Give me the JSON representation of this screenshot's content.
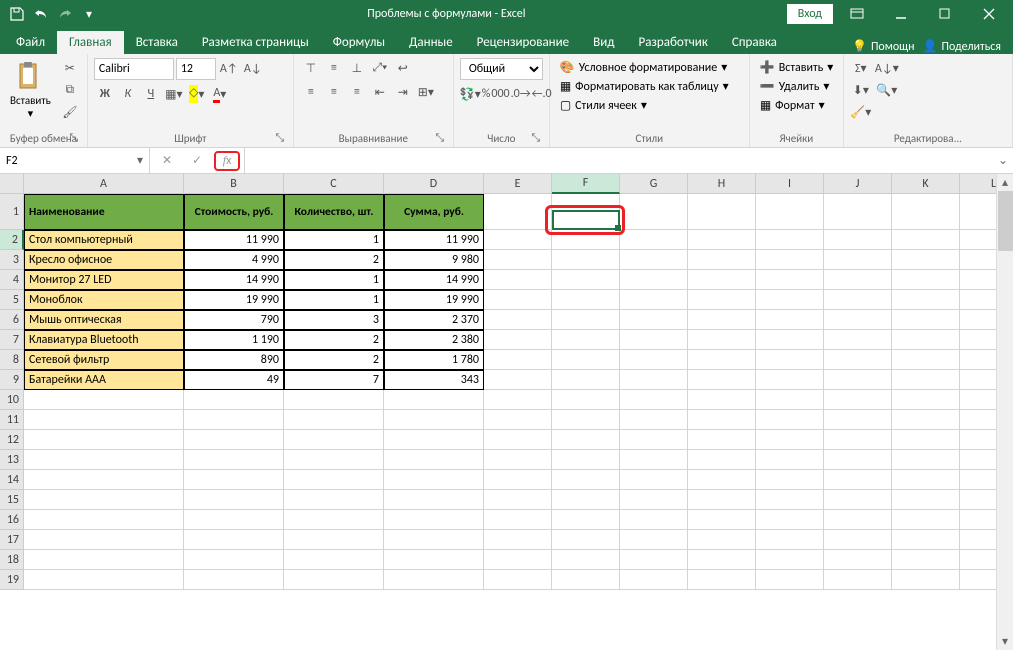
{
  "title": "Проблемы с формулами - Excel",
  "login": "Вход",
  "tabs": [
    "Файл",
    "Главная",
    "Вставка",
    "Разметка страницы",
    "Формулы",
    "Данные",
    "Рецензирование",
    "Вид",
    "Разработчик",
    "Справка"
  ],
  "active_tab": 1,
  "help_hint": "Помощн",
  "share": "Поделиться",
  "ribbon": {
    "clipboard": {
      "paste": "Вставить",
      "label": "Буфер обмена"
    },
    "font": {
      "name": "Calibri",
      "size": "12",
      "label": "Шрифт"
    },
    "alignment": {
      "label": "Выравнивание"
    },
    "number": {
      "format": "Общий",
      "label": "Число"
    },
    "styles": {
      "cond": "Условное форматирование",
      "table": "Форматировать как таблицу",
      "cell": "Стили ячеек",
      "label": "Стили"
    },
    "cells": {
      "insert": "Вставить",
      "delete": "Удалить",
      "format": "Формат",
      "label": "Ячейки"
    },
    "editing": {
      "label": "Редактирова..."
    }
  },
  "name_box": "F2",
  "formula": "",
  "columns": [
    "A",
    "B",
    "C",
    "D",
    "E",
    "F",
    "G",
    "H",
    "I",
    "J",
    "K",
    "L"
  ],
  "selected_col": "F",
  "selected_row": 2,
  "header_row": [
    "Наименование",
    "Стоимость, руб.",
    "Количество, шт.",
    "Сумма, руб."
  ],
  "data_rows": [
    {
      "name": "Стол компьютерный",
      "cost": "11 990",
      "qty": "1",
      "sum": "11 990"
    },
    {
      "name": "Кресло офисное",
      "cost": "4 990",
      "qty": "2",
      "sum": "9 980"
    },
    {
      "name": "Монитор 27 LED",
      "cost": "14 990",
      "qty": "1",
      "sum": "14 990"
    },
    {
      "name": "Моноблок",
      "cost": "19 990",
      "qty": "1",
      "sum": "19 990"
    },
    {
      "name": "Мышь оптическая",
      "cost": "790",
      "qty": "3",
      "sum": "2 370"
    },
    {
      "name": "Клавиатура Bluetooth",
      "cost": "1 190",
      "qty": "2",
      "sum": "2 380"
    },
    {
      "name": "Сетевой фильтр",
      "cost": "890",
      "qty": "2",
      "sum": "1 780"
    },
    {
      "name": "Батарейки AAA",
      "cost": "49",
      "qty": "7",
      "sum": "343"
    }
  ],
  "total_rows": 19
}
